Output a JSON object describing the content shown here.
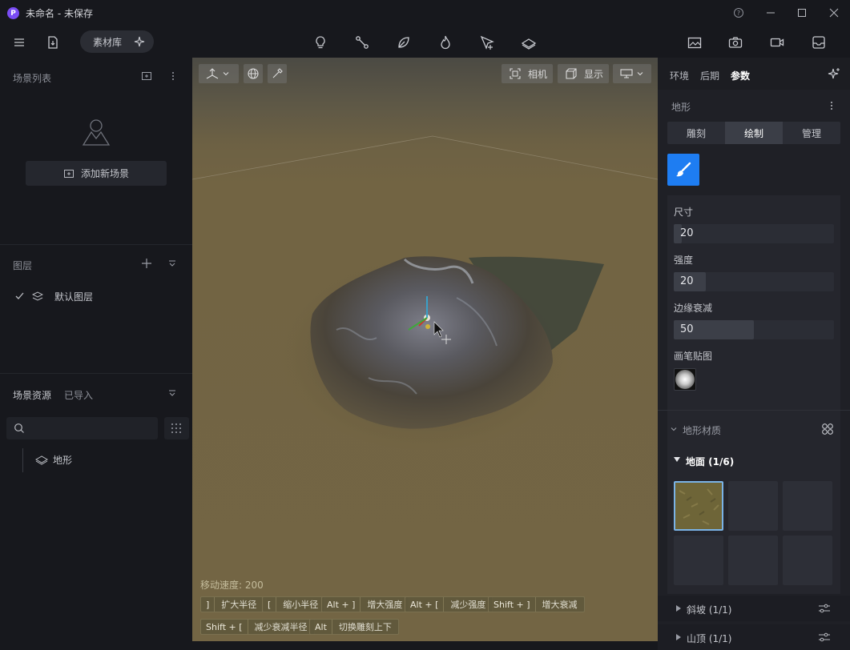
{
  "window": {
    "title": "未命名 - 未保存",
    "logo_letter": "P"
  },
  "topbar": {
    "library_label": "素材库"
  },
  "left": {
    "scene_list": {
      "title": "场景列表",
      "add_scene_label": "添加新场景"
    },
    "layers": {
      "title": "图层",
      "items": [
        {
          "label": "默认图层",
          "checked": true
        }
      ]
    },
    "assets": {
      "tabs": [
        "场景资源",
        "已导入"
      ],
      "search_placeholder": "",
      "items": [
        {
          "label": "地形"
        }
      ]
    }
  },
  "viewport": {
    "buttons": {
      "camera": "相机",
      "display": "显示"
    },
    "speed_label": "移动速度: 200",
    "hints": [
      {
        "key": "]",
        "text": "扩大半径"
      },
      {
        "key": "[",
        "text": "缩小半径"
      },
      {
        "key": "Alt + ]",
        "text": "增大强度"
      },
      {
        "key": "Alt + [",
        "text": "减少强度"
      },
      {
        "key": "Shift + ]",
        "text": "增大衰减"
      },
      {
        "key": "Shift + [",
        "text": "减少衰减半径"
      },
      {
        "key": "Alt",
        "text": "切换雕刻上下"
      }
    ]
  },
  "right": {
    "tabs": [
      "环境",
      "后期",
      "参数"
    ],
    "active_tab": "参数",
    "section_title": "地形",
    "modes": [
      "雕刻",
      "绘制",
      "管理"
    ],
    "active_mode": "绘制",
    "size": {
      "label": "尺寸",
      "value": "20",
      "fraction": 0.05
    },
    "strength": {
      "label": "强度",
      "value": "20",
      "fraction": 0.2
    },
    "falloff": {
      "label": "边缘衰减",
      "value": "50",
      "fraction": 0.5
    },
    "brush_texture": {
      "label": "画笔贴图"
    },
    "material": {
      "title": "地形材质"
    },
    "groups": [
      {
        "label": "地面 (1/6)",
        "expanded": true
      },
      {
        "label": "斜坡 (1/1)",
        "expanded": false
      },
      {
        "label": "山顶 (1/1)",
        "expanded": false
      }
    ]
  },
  "colors": {
    "accent": "#1e7df2",
    "brand": "#7a4cf5",
    "terrain": "#736544"
  }
}
